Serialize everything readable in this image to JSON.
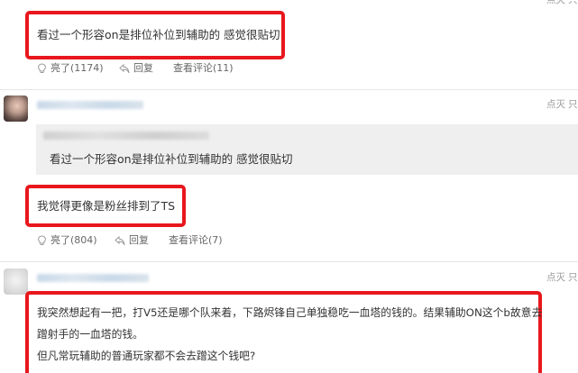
{
  "side_actions": {
    "report_label": "点灭",
    "extra_label": "只"
  },
  "comment1": {
    "text": "看过一个形容on是排位补位到辅助的 感觉很贴切",
    "like_label": "亮了",
    "like_count": "(1174)",
    "reply_label": "回复",
    "view_replies_label": "查看评论",
    "view_replies_count": "(11)"
  },
  "comment2": {
    "quote_text": "看过一个形容on是排位补位到辅助的 感觉很贴切",
    "text": "我觉得更像是粉丝排到了TS",
    "like_label": "亮了",
    "like_count": "(804)",
    "reply_label": "回复",
    "view_replies_label": "查看评论",
    "view_replies_count": "(7)"
  },
  "comment3": {
    "line1": "我突然想起有一把，打V5还是哪个队来着，下路烬锋自己单独稳吃一血塔的钱的。结果辅助ON这个b故意去",
    "line2": "蹭射手的一血塔的钱。",
    "line3": "但凡常玩辅助的普通玩家都不会去蹭这个钱吧?"
  },
  "colors": {
    "highlight_border": "#e8171d",
    "quote_background": "#efefef",
    "divider": "#e6e6e6"
  }
}
